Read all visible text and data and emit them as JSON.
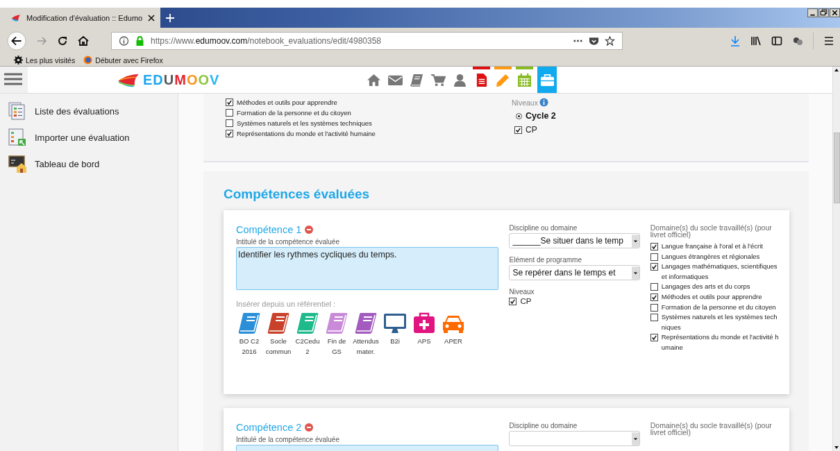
{
  "browser": {
    "tab": {
      "title": "Modification d'évaluation :: Edumo",
      "selected": true
    },
    "url": {
      "scheme": "https://www.",
      "domain": "edumoov.com",
      "path": "/notebook_evaluations/edit/4980358"
    },
    "bookmarks": [
      {
        "label": "Les plus visités",
        "kind": "gear"
      },
      {
        "label": "Débuter avec Firefox",
        "kind": "firefox"
      }
    ]
  },
  "site": {
    "logo": "EDUMOOV",
    "nav": [
      {
        "kind": "home",
        "color": "#777777",
        "flagged": false,
        "selected": false
      },
      {
        "kind": "mail",
        "color": "#777777",
        "flagged": false,
        "selected": false
      },
      {
        "kind": "book",
        "color": "#777777",
        "flagged": false,
        "selected": false
      },
      {
        "kind": "cart",
        "color": "#777777",
        "flagged": false,
        "selected": false
      },
      {
        "kind": "person",
        "color": "#777777",
        "flagged": false,
        "selected": false
      },
      {
        "kind": "document",
        "color": "#dd1111",
        "flagged": true,
        "selected": false
      },
      {
        "kind": "pencil",
        "color": "#ff9911",
        "flagged": true,
        "selected": false
      },
      {
        "kind": "calendar",
        "color": "#88bb22",
        "flagged": true,
        "selected": false
      },
      {
        "kind": "briefcase",
        "color": "#11aaee",
        "flagged": false,
        "selected": true
      }
    ]
  },
  "sidebar": {
    "items": [
      {
        "label": "Liste des évaluations",
        "kind": "list"
      },
      {
        "label": "Importer une évaluation",
        "kind": "import"
      },
      {
        "label": "Tableau de bord",
        "kind": "dashboard"
      }
    ]
  },
  "top_panel": {
    "socle": [
      {
        "label": "Méthodes et outils pour apprendre",
        "checked": true
      },
      {
        "label": "Formation de la personne et du citoyen",
        "checked": false
      },
      {
        "label": "Systèmes naturels et les systèmes techniques",
        "checked": false
      },
      {
        "label": "Représentations du monde et l'activité humaine",
        "checked": true
      }
    ],
    "niveaux_label": "Niveaux",
    "cycle": {
      "label": "Cycle 2",
      "selected": true
    },
    "levels": [
      {
        "label": "CP",
        "checked": true
      }
    ]
  },
  "section": {
    "title": "Compétences évaluées",
    "competences": [
      {
        "title": "Compétence 1",
        "intitule_label": "Intitulé de la compétence évaluée",
        "intitule": "Identifier les rythmes cycliques du temps.",
        "referentiel_label": "Insérer depuis un référentiel :",
        "referentiels": [
          {
            "label": "BO C2 2016",
            "kind": "book",
            "color": "#2a8fd8"
          },
          {
            "label": "Socle commun",
            "kind": "book",
            "color": "#c8412b"
          },
          {
            "label": "C2Cedu 2",
            "kind": "book",
            "color": "#1fba8c"
          },
          {
            "label": "Fin de GS",
            "kind": "book",
            "color": "#c98bd8"
          },
          {
            "label": "Attendus mater.",
            "kind": "book",
            "color": "#a35bbf"
          },
          {
            "label": "B2i",
            "kind": "monitor",
            "color": "#2f5f8f"
          },
          {
            "label": "APS",
            "kind": "medkit",
            "color": "#e0157f"
          },
          {
            "label": "APER",
            "kind": "car",
            "color": "#ff6a00"
          }
        ],
        "discipline_label": "Discipline ou domaine",
        "discipline": "______Se situer dans le temp",
        "element_label": "Elément de programme",
        "element": "Se repérer dans le temps et",
        "niveaux_label": "Niveaux",
        "niveaux": [
          {
            "label": "CP",
            "checked": true
          }
        ],
        "socle_label": "Domaine(s) du socle travaillé(s) (pour livret officiel)",
        "socle": [
          {
            "label": "Langue française à l'oral et à l'écrit",
            "checked": true
          },
          {
            "label": "Langues étrangères et régionales",
            "checked": false
          },
          {
            "label": "Langages mathématiques, scientifiques et informatiques",
            "checked": true
          },
          {
            "label": "Langages des arts et du corps",
            "checked": false
          },
          {
            "label": "Méthodes et outils pour apprendre",
            "checked": true
          },
          {
            "label": "Formation de la personne et du citoyen",
            "checked": false
          },
          {
            "label": "Systèmes naturels et les systèmes techniques",
            "checked": false
          },
          {
            "label": "Représentations du monde et l'activité humaine",
            "checked": true
          }
        ]
      },
      {
        "title": "Compétence 2",
        "intitule_label": "Intitulé de la compétence évaluée",
        "discipline_label": "Discipline ou domaine",
        "socle_label": "Domaine(s) du socle travaillé(s) (pour livret officiel)"
      }
    ]
  }
}
